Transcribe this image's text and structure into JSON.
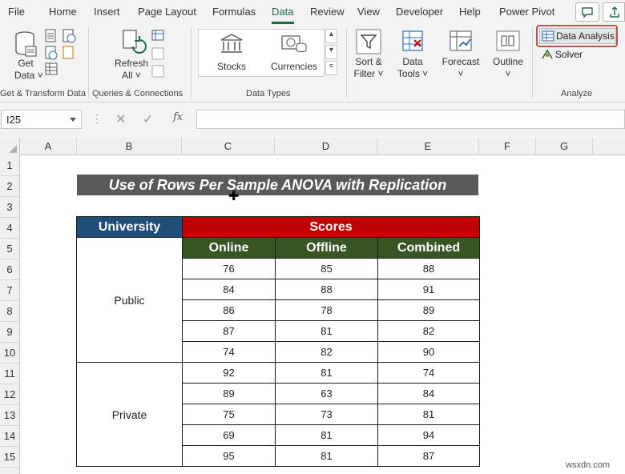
{
  "menu": {
    "items": [
      "File",
      "Home",
      "Insert",
      "Page Layout",
      "Formulas",
      "Data",
      "Review",
      "View",
      "Developer",
      "Help",
      "Power Pivot"
    ],
    "active": "Data"
  },
  "ribbon": {
    "get_data": "Get",
    "get_data_2": "Data ˅",
    "refresh": "Refresh",
    "refresh_2": "All ˅",
    "stocks": "Stocks",
    "currencies": "Currencies",
    "sort_filter": "Sort &",
    "sort_filter_2": "Filter ˅",
    "data_tools": "Data",
    "data_tools_2": "Tools ˅",
    "forecast": "Forecast",
    "forecast_2": "˅",
    "outline": "Outline",
    "outline_2": "˅",
    "data_analysis": "Data Analysis",
    "solver": "Solver",
    "groups": {
      "get_transform": "Get & Transform Data",
      "queries": "Queries & Connections",
      "data_types": "Data Types",
      "analyze": "Analyze"
    }
  },
  "formula_bar": {
    "name_box": "I25",
    "fx": "fx",
    "value": ""
  },
  "columns": [
    "A",
    "B",
    "C",
    "D",
    "E",
    "F",
    "G"
  ],
  "rows": [
    "1",
    "2",
    "3",
    "4",
    "5",
    "6",
    "7",
    "8",
    "9",
    "10",
    "11",
    "12",
    "13",
    "14",
    "15"
  ],
  "sheet": {
    "title": "Use of Rows Per Sample ANOVA with Replication",
    "header_university": "University",
    "header_scores": "Scores",
    "sub_headers": [
      "Online",
      "Offline",
      "Combined"
    ],
    "groups": [
      {
        "name": "Public",
        "rows": [
          [
            "76",
            "85",
            "88"
          ],
          [
            "84",
            "88",
            "91"
          ],
          [
            "86",
            "78",
            "89"
          ],
          [
            "87",
            "81",
            "82"
          ],
          [
            "74",
            "82",
            "90"
          ]
        ]
      },
      {
        "name": "Private",
        "rows": [
          [
            "92",
            "81",
            "74"
          ],
          [
            "89",
            "63",
            "84"
          ],
          [
            "75",
            "73",
            "81"
          ],
          [
            "69",
            "81",
            "94"
          ],
          [
            "95",
            "81",
            "87"
          ]
        ]
      }
    ]
  },
  "watermark": "wsxdn.com",
  "colors": {
    "accent": "#1e6e42",
    "university_header": "#1f4e79",
    "scores_header": "#c00000",
    "sub_header": "#375623",
    "title_bar": "#595959",
    "highlight_box": "#c0504d"
  }
}
